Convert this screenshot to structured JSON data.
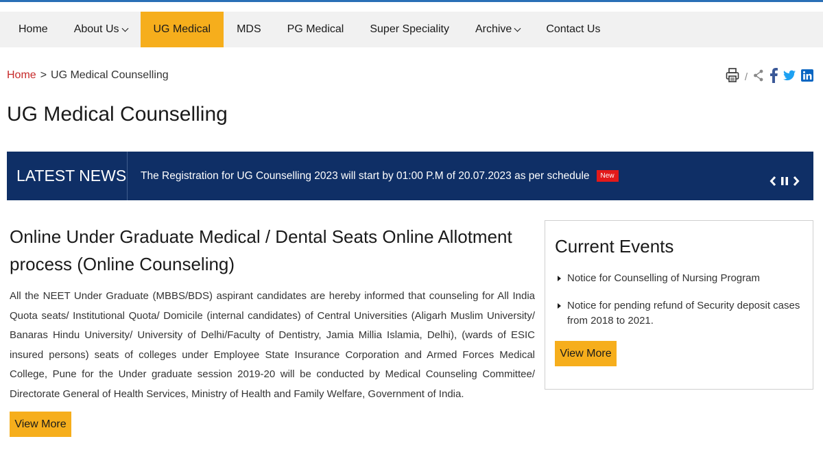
{
  "nav": {
    "items": [
      {
        "label": "Home",
        "dropdown": false,
        "active": false
      },
      {
        "label": "About Us",
        "dropdown": true,
        "active": false
      },
      {
        "label": "UG Medical",
        "dropdown": false,
        "active": true
      },
      {
        "label": "MDS",
        "dropdown": false,
        "active": false
      },
      {
        "label": "PG Medical",
        "dropdown": false,
        "active": false
      },
      {
        "label": "Super Speciality",
        "dropdown": false,
        "active": false
      },
      {
        "label": "Archive",
        "dropdown": true,
        "active": false
      },
      {
        "label": "Contact Us",
        "dropdown": false,
        "active": false
      }
    ]
  },
  "breadcrumb": {
    "home": "Home",
    "separator": ">",
    "current": "UG Medical Counselling"
  },
  "social": {
    "icons": [
      "print-icon",
      "share-icon",
      "facebook-icon",
      "twitter-icon",
      "linkedin-icon"
    ],
    "separator": "/"
  },
  "page": {
    "title": "UG Medical Counselling"
  },
  "news": {
    "label": "LATEST NEWS",
    "text": "The Registration for UG Counselling 2023 will start by 01:00 P.M of 20.07.2023 as per schedule",
    "badge": "New"
  },
  "main": {
    "title": "Online Under Graduate Medical / Dental Seats Online Allotment process (Online Counseling)",
    "body": "All the NEET Under Graduate (MBBS/BDS) aspirant candidates are hereby informed that counseling for All India Quota seats/ Institutional Quota/ Domicile (internal candidates) of Central Universities (Aligarh Muslim University/ Banaras Hindu University/ University of Delhi/Faculty of Dentistry, Jamia Millia Islamia, Delhi), (wards of ESIC insured persons) seats of colleges under Employee State Insurance Corporation and Armed Forces Medical College, Pune for the Under graduate session 2019-20 will be conducted by Medical Counseling Committee/ Directorate General of Health Services, Ministry of Health and Family Welfare, Government of India.",
    "button": "View More"
  },
  "events": {
    "title": "Current Events",
    "items": [
      "Notice for Counselling of Nursing Program",
      "Notice for pending refund of Security deposit cases from 2018 to 2021."
    ],
    "button": "View More"
  },
  "colors": {
    "accent": "#f6ae1c",
    "news_bg": "#0f2f66",
    "badge": "#e21a1a",
    "breadcrumb_home": "#c62828",
    "facebook": "#3b5998",
    "twitter": "#1da1f2",
    "linkedin": "#0a66c2"
  }
}
